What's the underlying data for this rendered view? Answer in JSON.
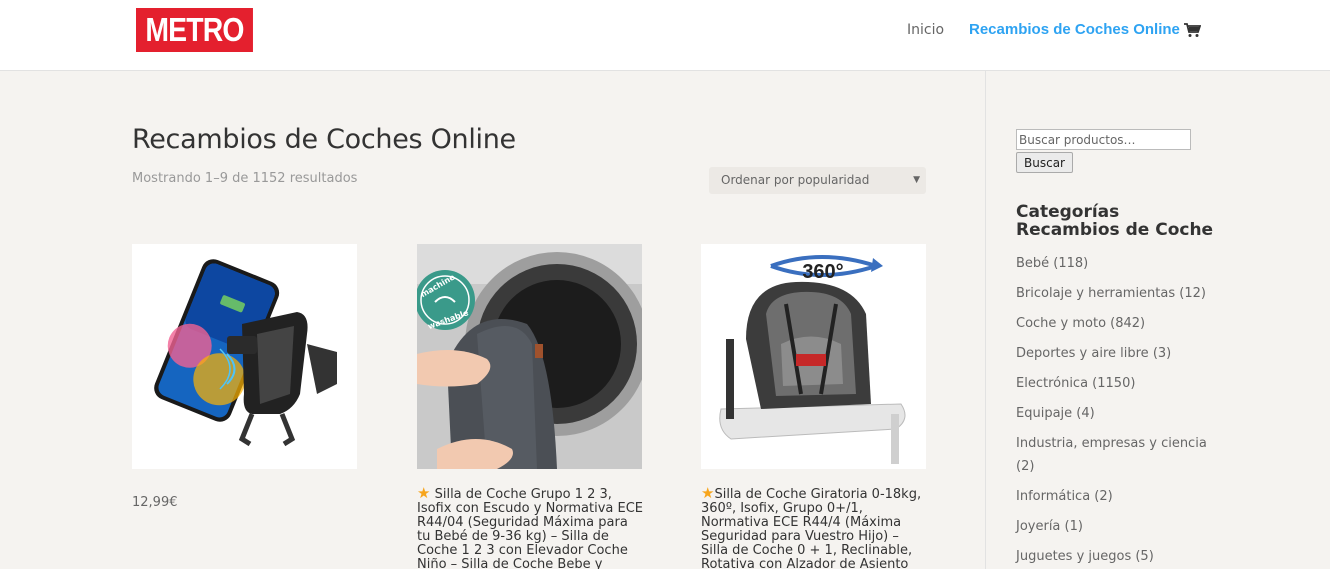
{
  "header": {
    "logo_text": "METRO",
    "nav": [
      {
        "label": "Inicio"
      },
      {
        "label": "Recambios de Coches Online"
      }
    ]
  },
  "main": {
    "title": "Recambios de Coches Online",
    "result_count": "Mostrando 1–9 de 1152 resultados",
    "orderby": "Ordenar por popularidad",
    "products": [
      {
        "price": "12,99€"
      },
      {
        "title": "Silla de Coche Grupo 1 2 3, Isofix con Escudo y Normativa ECE R44/04 (Seguridad Máxima para tu Bebé de 9-36 kg) – Silla de Coche 1 2 3 con Elevador Coche Niño – Silla de Coche Bebe y"
      },
      {
        "title": "Silla de Coche Giratoria 0-18kg, 360º, Isofix, Grupo 0+/1, Normativa ECE R44/4 (Máxima Seguridad para Vuestro Hijo) – Silla de Coche 0 + 1, Reclinable, Rotativa con Alzador de Asiento"
      }
    ],
    "product_badges": {
      "washable_line1": "machine",
      "washable_line2": "washable",
      "rotation": "360°"
    }
  },
  "sidebar": {
    "search_placeholder": "Buscar productos…",
    "search_button": "Buscar",
    "widget_title": "Categorías Recambios de Coche",
    "categories": [
      "Bebé (118)",
      "Bricolaje y herramientas (12)",
      "Coche y moto (842)",
      "Deportes y aire libre (3)",
      "Electrónica (1150)",
      "Equipaje (4)",
      "Industria, empresas y ciencia (2)",
      "Informática (2)",
      "Joyería (1)",
      "Juguetes y juegos (5)"
    ]
  },
  "colors": {
    "brand": "#e4202e",
    "accent": "#2ea3f2",
    "star": "#f7a51c"
  }
}
